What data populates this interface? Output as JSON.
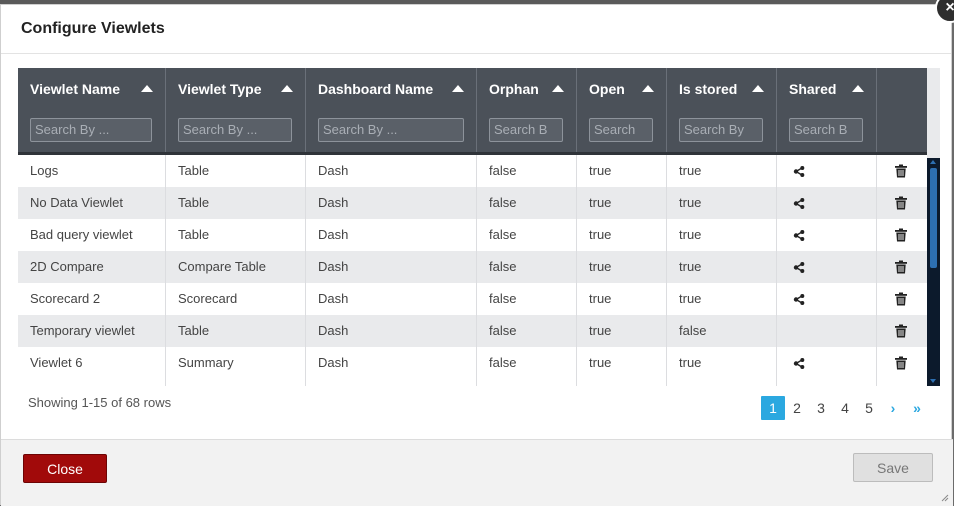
{
  "dialog": {
    "title": "Configure Viewlets",
    "close_icon": "×"
  },
  "columns": [
    {
      "label": "Viewlet Name",
      "filter_placeholder": "Search By ..."
    },
    {
      "label": "Viewlet Type",
      "filter_placeholder": "Search By ..."
    },
    {
      "label": "Dashboard Name",
      "filter_placeholder": "Search By ..."
    },
    {
      "label": "Orphan",
      "filter_placeholder": "Search B"
    },
    {
      "label": "Open",
      "filter_placeholder": "Search"
    },
    {
      "label": "Is stored",
      "filter_placeholder": "Search By"
    },
    {
      "label": "Shared",
      "filter_placeholder": "Search B"
    }
  ],
  "rows": [
    {
      "name": "Logs",
      "type": "Table",
      "dashboard": "Dash",
      "orphan": "false",
      "open": "true",
      "stored": "true",
      "shared": true
    },
    {
      "name": "No Data Viewlet",
      "type": "Table",
      "dashboard": "Dash",
      "orphan": "false",
      "open": "true",
      "stored": "true",
      "shared": true
    },
    {
      "name": "Bad query viewlet",
      "type": "Table",
      "dashboard": "Dash",
      "orphan": "false",
      "open": "true",
      "stored": "true",
      "shared": true
    },
    {
      "name": "2D Compare",
      "type": "Compare Table",
      "dashboard": "Dash",
      "orphan": "false",
      "open": "true",
      "stored": "true",
      "shared": true
    },
    {
      "name": "Scorecard 2",
      "type": "Scorecard",
      "dashboard": "Dash",
      "orphan": "false",
      "open": "true",
      "stored": "true",
      "shared": true
    },
    {
      "name": "Temporary viewlet",
      "type": "Table",
      "dashboard": "Dash",
      "orphan": "false",
      "open": "true",
      "stored": "false",
      "shared": false
    },
    {
      "name": "Viewlet 6",
      "type": "Summary",
      "dashboard": "Dash",
      "orphan": "false",
      "open": "true",
      "stored": "true",
      "shared": true
    }
  ],
  "icons": {
    "share": "share-icon",
    "delete": "trash-icon"
  },
  "footer": {
    "showing": "Showing 1-15 of 68 rows"
  },
  "pagination": {
    "pages": [
      "1",
      "2",
      "3",
      "4",
      "5"
    ],
    "active": "1",
    "next": "›",
    "last": "»"
  },
  "buttons": {
    "close": "Close",
    "save": "Save"
  },
  "colors": {
    "header_bg": "#4b5159",
    "accent": "#2ba8e0",
    "close_btn": "#a10a0a"
  }
}
